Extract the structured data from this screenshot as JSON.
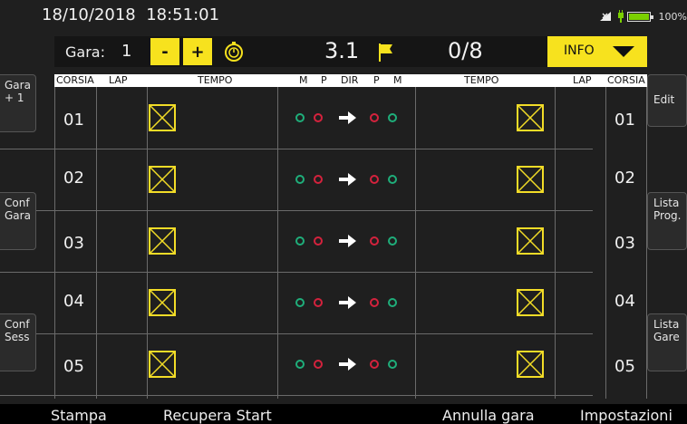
{
  "status": {
    "datetime": "18/10/2018  18:51:01",
    "battery": "100%"
  },
  "topbar": {
    "gara_label": "Gara:",
    "gara_number": "1",
    "minus_label": "-",
    "plus_label": "+",
    "time_value": "3.1",
    "laps_value": "0/8",
    "info_label": "INFO"
  },
  "header": {
    "corsia_left": "CORSIA",
    "lap_left": "LAP",
    "tempo_left": "TEMPO",
    "m1": "M",
    "p1": "P",
    "dir": "DIR",
    "p2": "P",
    "m2": "M",
    "tempo_right": "TEMPO",
    "lap_right": "LAP",
    "corsia_right": "CORSIA"
  },
  "lanes": [
    "01",
    "02",
    "03",
    "04",
    "05"
  ],
  "colors": {
    "accent": "#f7e21e",
    "green_dot": "#1fae7a",
    "red_dot": "#d4223d"
  },
  "left_buttons": [
    {
      "label": "Gara\n+ 1"
    },
    {
      "label": "Conf\nGara"
    },
    {
      "label": "Conf\nSess"
    }
  ],
  "right_buttons": [
    {
      "label": "Edit"
    },
    {
      "label": "Lista\nProg."
    },
    {
      "label": "Lista\nGare"
    }
  ],
  "footer": {
    "stampa": "Stampa",
    "recupera": "Recupera Start",
    "annulla": "Annulla gara",
    "impostazioni": "Impostazioni"
  },
  "icons": {
    "timer": "stopwatch-icon",
    "flag": "flag-icon",
    "signal": "signal-icon",
    "battery": "battery-icon"
  }
}
